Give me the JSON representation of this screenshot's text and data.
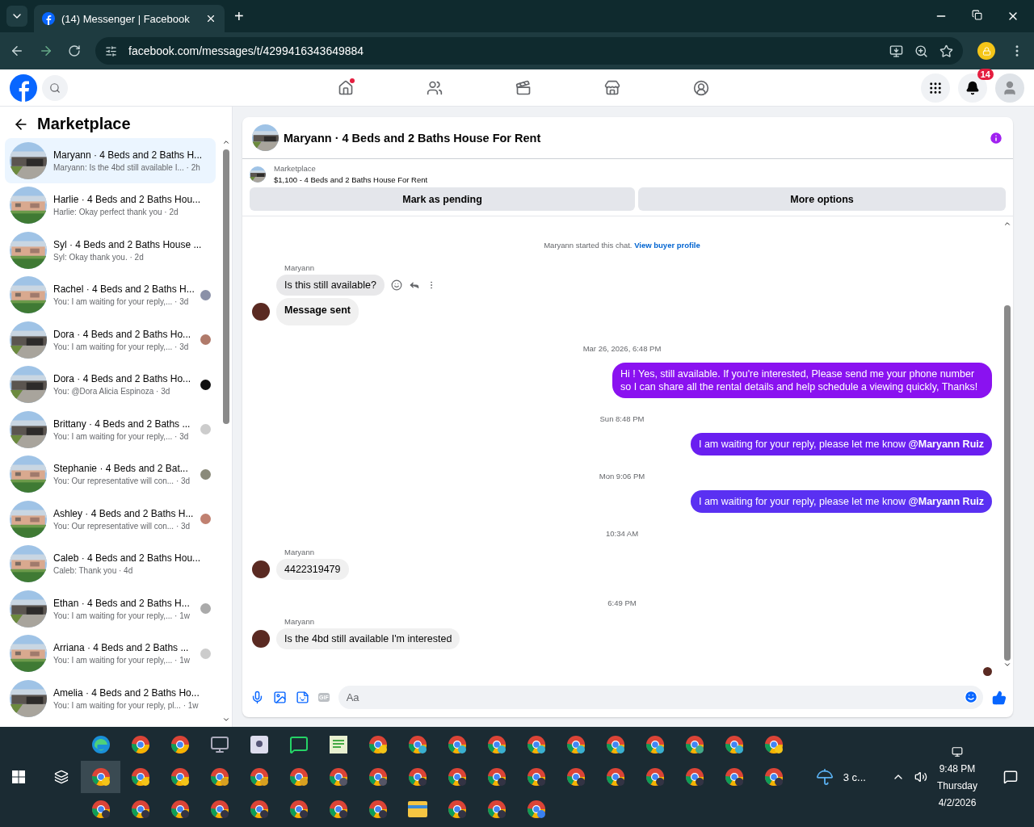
{
  "browser": {
    "tab_title": "(14) Messenger | Facebook",
    "new_tab": "+",
    "url": "facebook.com/messages/t/4299416343649884"
  },
  "header": {
    "nav": [
      {
        "kind": "home",
        "dot": true
      },
      {
        "kind": "friends",
        "dot": false
      },
      {
        "kind": "video",
        "dot": false
      },
      {
        "kind": "store",
        "dot": false
      },
      {
        "kind": "groups",
        "dot": false
      }
    ],
    "notification_count": "14"
  },
  "sidebar": {
    "title": "Marketplace",
    "conversations": [
      {
        "title": "Maryann · 4 Beds and 2 Baths H...",
        "preview": "Maryann: Is the 4bd still available I...",
        "time": "· 2h",
        "selected": true,
        "seen": false
      },
      {
        "title": "Harlie · 4 Beds and 2 Baths Hou...",
        "preview": "Harlie: Okay perfect thank you",
        "time": "· 2d",
        "selected": false,
        "seen": false
      },
      {
        "title": "Syl · 4 Beds and 2 Baths House ...",
        "preview": "Syl: Okay thank you.",
        "time": "· 2d",
        "selected": false,
        "seen": false
      },
      {
        "title": "Rachel · 4 Beds and 2 Baths H...",
        "preview": "You: I am waiting for your reply,...",
        "time": "· 3d",
        "selected": false,
        "seen": true
      },
      {
        "title": "Dora · 4 Beds and 2 Baths Ho...",
        "preview": "You: I am waiting for your reply,...",
        "time": "· 3d",
        "selected": false,
        "seen": true
      },
      {
        "title": "Dora · 4 Beds and 2 Baths Ho...",
        "preview": "You: @Dora Alicia Espinoza",
        "time": "· 3d",
        "selected": false,
        "seen": true
      },
      {
        "title": "Brittany · 4 Beds and 2 Baths ...",
        "preview": "You: I am waiting for your reply,...",
        "time": "· 3d",
        "selected": false,
        "seen": true
      },
      {
        "title": "Stephanie · 4 Beds and 2 Bat...",
        "preview": "You: Our representative will con...",
        "time": "· 3d",
        "selected": false,
        "seen": true
      },
      {
        "title": "Ashley · 4 Beds and 2 Baths H...",
        "preview": "You: Our representative will con...",
        "time": "· 3d",
        "selected": false,
        "seen": true
      },
      {
        "title": "Caleb · 4 Beds and 2 Baths Hou...",
        "preview": "Caleb: Thank you",
        "time": "· 4d",
        "selected": false,
        "seen": false
      },
      {
        "title": "Ethan · 4 Beds and 2 Baths H...",
        "preview": "You: I am waiting for your reply,...",
        "time": "· 1w",
        "selected": false,
        "seen": true
      },
      {
        "title": "Arriana · 4 Beds and 2 Baths ...",
        "preview": "You: I am waiting for your reply,...",
        "time": "· 1w",
        "selected": false,
        "seen": true
      },
      {
        "title": "Amelia · 4 Beds and 2 Baths Ho...",
        "preview": "You: I am waiting for your reply, pl...",
        "time": "· 1w",
        "selected": false,
        "seen": false
      }
    ]
  },
  "chat": {
    "title": "Maryann · 4 Beds and 2 Baths House For Rent",
    "listing": {
      "label": "Marketplace",
      "text": "$1,100 - 4 Beds and 2 Baths House For Rent"
    },
    "buttons": [
      "Mark as pending",
      "More options"
    ],
    "messages": [
      {
        "kind": "system",
        "text": "Maryann started this chat.",
        "link": "View buyer profile"
      },
      {
        "kind": "sender",
        "text": "Maryann"
      },
      {
        "kind": "incoming",
        "text": "Is this still available?",
        "bold": false,
        "avatar": false,
        "actions": true
      },
      {
        "kind": "incoming",
        "text": "Message sent",
        "bold": true,
        "avatar": true,
        "actions": false
      },
      {
        "kind": "time",
        "text": "Mar 26, 2026, 6:48 PM"
      },
      {
        "kind": "outgoing",
        "text": "Hi ! Yes, still available. If you're interested, Please send me your phone number so I can share all the rental details and help schedule a viewing quickly, Thanks!"
      },
      {
        "kind": "time",
        "text": "Sun 8:48 PM"
      },
      {
        "kind": "outgoing",
        "text": "I am waiting for your reply, please let me know **@Maryann Ruiz**"
      },
      {
        "kind": "time",
        "text": "Mon 9:06 PM"
      },
      {
        "kind": "outgoing",
        "text": "I am waiting for your reply, please let me know **@Maryann Ruiz**"
      },
      {
        "kind": "time",
        "text": "10:34 AM"
      },
      {
        "kind": "sender",
        "text": "Maryann"
      },
      {
        "kind": "incoming",
        "text": "4422319479",
        "bold": false,
        "avatar": true,
        "actions": false
      },
      {
        "kind": "time",
        "text": "6:49 PM"
      },
      {
        "kind": "sender",
        "text": "Maryann"
      },
      {
        "kind": "incoming",
        "text": "Is the 4bd still available I'm interested",
        "bold": false,
        "avatar": true,
        "actions": false
      }
    ],
    "gif_label": "GIF",
    "composer": {
      "placeholder": "Aa"
    }
  },
  "taskbar": {
    "weather": "3 c...",
    "time": "9:48 PM",
    "day": "Thursday",
    "date": "4/2/2026"
  }
}
